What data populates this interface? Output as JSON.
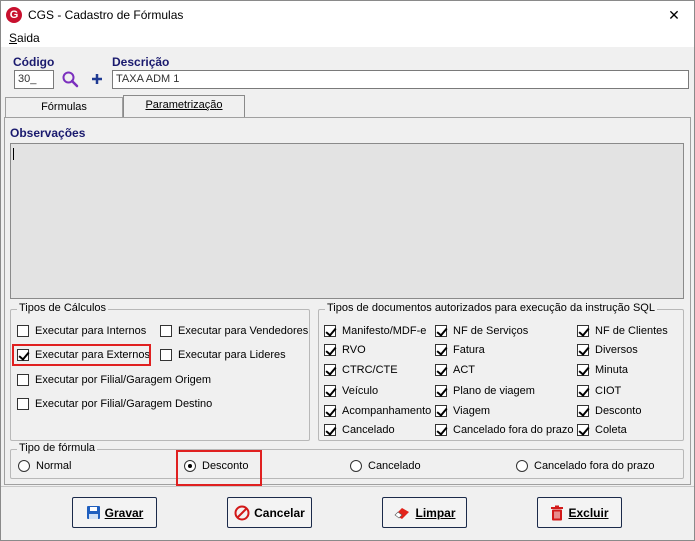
{
  "window": {
    "title": "CGS - Cadastro de Fórmulas",
    "close_glyph": "✕",
    "logo_letter": "G"
  },
  "menu": {
    "saida_first": "S",
    "saida_rest": "aida"
  },
  "form": {
    "codigo_label": "Código",
    "codigo_value": "30_",
    "descricao_label": "Descrição",
    "descricao_value": "TAXA ADM 1"
  },
  "tabs": [
    {
      "label": "Fórmulas",
      "active": false
    },
    {
      "label": "Parametrização",
      "active": true
    }
  ],
  "observacoes_label": "Observações",
  "tipos_calculos": {
    "title": "Tipos de Cálculos",
    "items": [
      {
        "label": "Executar para Internos",
        "checked": false
      },
      {
        "label": "Executar para Vendedores",
        "checked": false
      },
      {
        "label": "Executar para Externos",
        "checked": true
      },
      {
        "label": "Executar para Lideres",
        "checked": false
      },
      {
        "label": "Executar por Filial/Garagem Origem",
        "checked": false
      },
      {
        "label": "Executar por Filial/Garagem Destino",
        "checked": false
      }
    ]
  },
  "tipos_documentos": {
    "title": "Tipos de documentos autorizados para execução da instrução SQL",
    "items": [
      {
        "label": "Manifesto/MDF-e",
        "checked": true
      },
      {
        "label": "NF de Serviços",
        "checked": true
      },
      {
        "label": "NF de Clientes",
        "checked": true
      },
      {
        "label": "RVO",
        "checked": true
      },
      {
        "label": "Fatura",
        "checked": true
      },
      {
        "label": "Diversos",
        "checked": true
      },
      {
        "label": "CTRC/CTE",
        "checked": true
      },
      {
        "label": "ACT",
        "checked": true
      },
      {
        "label": "Minuta",
        "checked": true
      },
      {
        "label": "Veículo",
        "checked": true
      },
      {
        "label": "Plano de viagem",
        "checked": true
      },
      {
        "label": "CIOT",
        "checked": true
      },
      {
        "label": "Acompanhamento",
        "checked": true
      },
      {
        "label": "Viagem",
        "checked": true
      },
      {
        "label": "Desconto",
        "checked": true
      },
      {
        "label": "Cancelado",
        "checked": true
      },
      {
        "label": "Cancelado fora do prazo",
        "checked": true
      },
      {
        "label": "Coleta",
        "checked": true
      }
    ]
  },
  "tipo_formula": {
    "title": "Tipo de fórmula",
    "options": [
      {
        "label": "Normal",
        "selected": false
      },
      {
        "label": "Desconto",
        "selected": true
      },
      {
        "label": "Cancelado",
        "selected": false
      },
      {
        "label": "Cancelado fora do prazo",
        "selected": false
      }
    ]
  },
  "buttons": {
    "gravar": "Gravar",
    "cancelar": "Cancelar",
    "limpar": "Limpar",
    "excluir": "Excluir"
  },
  "colors": {
    "highlight": "#e02020",
    "label_blue": "#1a1a6e",
    "accent_purple": "#7b2fbe",
    "accent_blue": "#1f3a93"
  }
}
